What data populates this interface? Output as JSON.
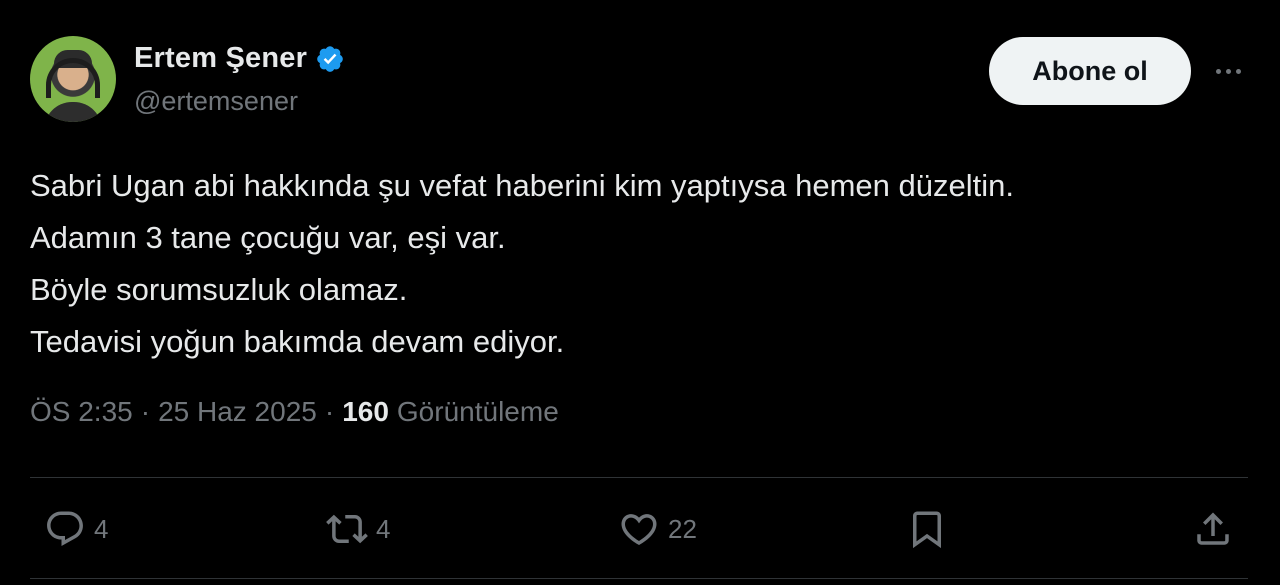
{
  "author": {
    "name": "Ertem Şener",
    "handle": "@ertemsener",
    "verified_color": "#1d9bf0"
  },
  "follow_button": {
    "label": "Abone ol"
  },
  "more_menu": {
    "icon": "more-horizontal-icon"
  },
  "tweet": {
    "lines": [
      "Sabri Ugan abi hakkında şu vefat haberini kim yaptıysa hemen düzeltin.",
      "Adamın 3 tane çocuğu var, eşi var.",
      "Böyle sorumsuzluk olamaz.",
      "Tedavisi yoğun bakımda devam ediyor."
    ]
  },
  "meta": {
    "time": "ÖS 2:35",
    "separator": "·",
    "date": "25 Haz 2025",
    "views_count": "160",
    "views_label": "Görüntüleme"
  },
  "actions": {
    "reply": {
      "icon": "reply-icon",
      "count": "4"
    },
    "retweet": {
      "icon": "retweet-icon",
      "count": "4"
    },
    "like": {
      "icon": "heart-icon",
      "count": "22"
    },
    "bookmark": {
      "icon": "bookmark-icon"
    },
    "share": {
      "icon": "share-icon"
    }
  },
  "colors": {
    "background": "#000000",
    "text": "#e7e9ea",
    "secondary": "#71767b",
    "divider": "#2f3336",
    "button_bg": "#eff3f4"
  }
}
